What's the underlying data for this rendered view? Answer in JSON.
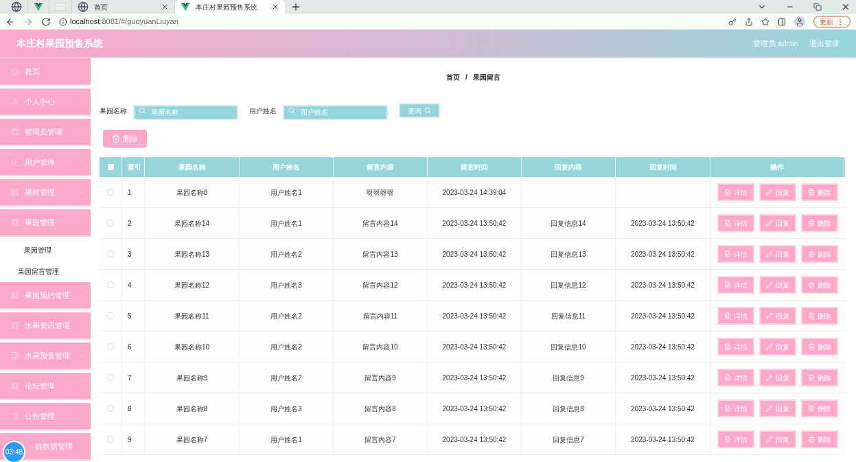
{
  "browser": {
    "tabs": [
      {
        "kind": "globe",
        "selected": false
      },
      {
        "kind": "vue",
        "selected": false
      },
      {
        "kind": "blank",
        "selected": false
      },
      {
        "kind": "globe",
        "label": "首页",
        "selected": false
      },
      {
        "kind": "vue",
        "label": "本庄村果园预售系统",
        "selected": true
      }
    ],
    "address": {
      "host": "localhost",
      "rest": ":8081/#/guoyuanLiuyan"
    },
    "update_button": "更新"
  },
  "header": {
    "title": "本庄村果园预售系统",
    "user": "管理员 admin",
    "logout": "退出登录"
  },
  "sidebar": {
    "items": [
      {
        "kind": "home",
        "label": "首页",
        "has_arrow": false
      },
      {
        "kind": "user",
        "label": "个人中心",
        "expanded": false,
        "has_arrow": true
      },
      {
        "kind": "case",
        "label": "管理员管理",
        "expanded": false,
        "has_arrow": true
      },
      {
        "kind": "chart",
        "label": "用户管理",
        "expanded": false,
        "has_arrow": true
      },
      {
        "kind": "grid",
        "label": "果树管理",
        "expanded": false,
        "has_arrow": true
      },
      {
        "kind": "grid",
        "label": "果园管理",
        "expanded": true,
        "has_arrow": true,
        "children": [
          {
            "label": "果园管理"
          },
          {
            "label": "果园留言管理"
          }
        ]
      },
      {
        "kind": "grid",
        "label": "果园预约管理",
        "expanded": false,
        "has_arrow": true
      },
      {
        "kind": "grid",
        "label": "水果资讯管理",
        "expanded": false,
        "has_arrow": true
      },
      {
        "kind": "doc",
        "label": "水果预售管理",
        "expanded": false,
        "has_arrow": true
      },
      {
        "kind": "grid",
        "label": "论坛管理",
        "expanded": false,
        "has_arrow": true
      },
      {
        "kind": "list",
        "label": "公告管理",
        "expanded": false,
        "has_arrow": true
      },
      {
        "kind": "covered",
        "label": "础数据管理",
        "expanded": false,
        "has_arrow": true
      }
    ]
  },
  "breadcrumb": [
    "首页",
    "/",
    "果园留言"
  ],
  "search": {
    "fields": [
      {
        "label": "果园名称",
        "placeholder": "果园名称"
      },
      {
        "label": "用户姓名",
        "placeholder": "用户姓名"
      }
    ],
    "button": "查询"
  },
  "delete_button": "删除",
  "table": {
    "all_checked": false,
    "columns": [
      "索引",
      "果园名称",
      "用户姓名",
      "留言内容",
      "留言时间",
      "回复内容",
      "回复时间",
      "操作"
    ],
    "rows": [
      {
        "selected": false,
        "cells": [
          "1",
          "果园名称8",
          "用户姓名1",
          "呀呀呀呀",
          "2023-03-24 14:39:04",
          "",
          ""
        ],
        "actions": [
          {
            "kind": "detail",
            "label": "详情"
          },
          {
            "kind": "reply",
            "label": "回复"
          },
          {
            "kind": "delete",
            "label": "删除"
          }
        ]
      },
      {
        "selected": false,
        "cells": [
          "2",
          "果园名称14",
          "用户姓名1",
          "留言内容14",
          "2023-03-24 13:50:42",
          "回复信息14",
          "2023-03-24 13:50:42"
        ],
        "actions": [
          {
            "kind": "detail",
            "label": "详情"
          },
          {
            "kind": "reply",
            "label": "回复"
          },
          {
            "kind": "delete",
            "label": "删除"
          }
        ]
      },
      {
        "selected": false,
        "cells": [
          "3",
          "果园名称13",
          "用户姓名2",
          "留言内容13",
          "2023-03-24 13:50:42",
          "回复信息13",
          "2023-03-24 13:50:42"
        ],
        "actions": [
          {
            "kind": "detail",
            "label": "详情"
          },
          {
            "kind": "reply",
            "label": "回复"
          },
          {
            "kind": "delete",
            "label": "删除"
          }
        ]
      },
      {
        "selected": false,
        "cells": [
          "4",
          "果园名称12",
          "用户姓名3",
          "留言内容12",
          "2023-03-24 13:50:42",
          "回复信息12",
          "2023-03-24 13:50:42"
        ],
        "actions": [
          {
            "kind": "detail",
            "label": "详情"
          },
          {
            "kind": "reply",
            "label": "回复"
          },
          {
            "kind": "delete",
            "label": "删除"
          }
        ]
      },
      {
        "selected": false,
        "cells": [
          "5",
          "果园名称11",
          "用户姓名2",
          "留言内容11",
          "2023-03-24 13:50:42",
          "回复信息11",
          "2023-03-24 13:50:42"
        ],
        "actions": [
          {
            "kind": "detail",
            "label": "详情"
          },
          {
            "kind": "reply",
            "label": "回复"
          },
          {
            "kind": "delete",
            "label": "删除"
          }
        ]
      },
      {
        "selected": false,
        "cells": [
          "6",
          "果园名称10",
          "用户姓名2",
          "留言内容10",
          "2023-03-24 13:50:42",
          "回复信息10",
          "2023-03-24 13:50:42"
        ],
        "actions": [
          {
            "kind": "detail",
            "label": "详情"
          },
          {
            "kind": "reply",
            "label": "回复"
          },
          {
            "kind": "delete",
            "label": "删除"
          }
        ]
      },
      {
        "selected": false,
        "cells": [
          "7",
          "果园名称9",
          "用户姓名2",
          "留言内容9",
          "2023-03-24 13:50:42",
          "回复信息9",
          "2023-03-24 13:50:42"
        ],
        "actions": [
          {
            "kind": "detail",
            "label": "详情"
          },
          {
            "kind": "reply",
            "label": "回复"
          },
          {
            "kind": "delete",
            "label": "删除"
          }
        ]
      },
      {
        "selected": false,
        "cells": [
          "8",
          "果园名称8",
          "用户姓名3",
          "留言内容8",
          "2023-03-24 13:50:42",
          "回复信息8",
          "2023-03-24 13:50:42"
        ],
        "actions": [
          {
            "kind": "detail",
            "label": "详情"
          },
          {
            "kind": "reply",
            "label": "回复"
          },
          {
            "kind": "delete",
            "label": "删除"
          }
        ]
      },
      {
        "selected": false,
        "cells": [
          "9",
          "果园名称7",
          "用户姓名1",
          "留言内容7",
          "2023-03-24 13:50:42",
          "回复信息7",
          "2023-03-24 13:50:42"
        ],
        "actions": [
          {
            "kind": "detail",
            "label": "详情"
          },
          {
            "kind": "reply",
            "label": "回复"
          },
          {
            "kind": "delete",
            "label": "删除"
          }
        ]
      }
    ]
  },
  "timer": "03:48"
}
